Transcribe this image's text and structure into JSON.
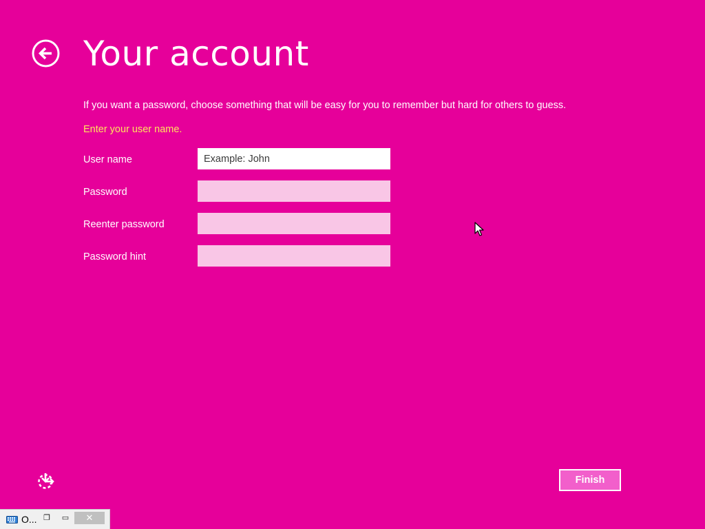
{
  "header": {
    "back_icon": "back-arrow-circle-icon",
    "title": "Your account"
  },
  "intro": "If you want a password, choose something that will be easy for you to remember but hard for others to guess.",
  "validation_message": "Enter your user name.",
  "form": {
    "fields": [
      {
        "label": "User name",
        "value": "",
        "placeholder": "Example: John",
        "active": true
      },
      {
        "label": "Password",
        "value": "",
        "placeholder": ""
      },
      {
        "label": "Reenter password",
        "value": "",
        "placeholder": ""
      },
      {
        "label": "Password hint",
        "value": "",
        "placeholder": ""
      }
    ]
  },
  "footer": {
    "ease_of_access_icon": "ease-of-access-icon",
    "finish_label": "Finish"
  },
  "mini_window": {
    "icon": "keyboard-icon",
    "title": "O...",
    "restore_glyph": "❐",
    "maximize_glyph": "▭",
    "close_glyph": "✕"
  },
  "colors": {
    "background": "#e6009a",
    "validation": "#ffe45c",
    "input_inactive": "#f9c6e6",
    "finish_button": "#f25fcb"
  }
}
